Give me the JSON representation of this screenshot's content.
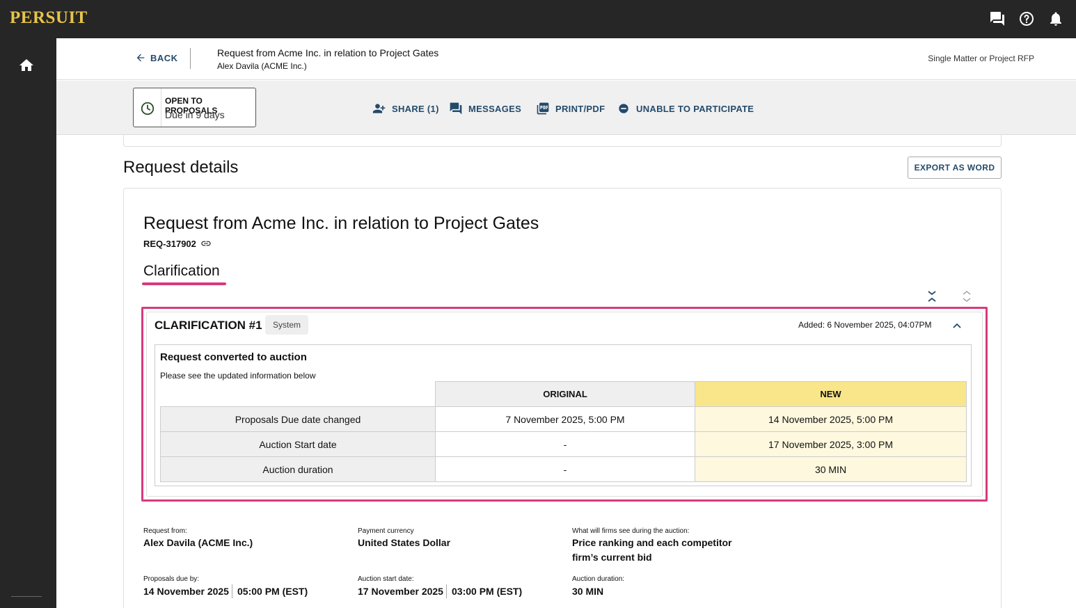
{
  "app": {
    "logo": "PERSUIT"
  },
  "header": {
    "back_label": "BACK",
    "request_title": "Request from Acme Inc. in relation to Project Gates",
    "requester": "Alex Davila (ACME Inc.)",
    "rfp_type": "Single Matter or Project RFP"
  },
  "status": {
    "title": "OPEN TO PROPOSALS",
    "due": "Due in 9 days"
  },
  "actions": {
    "share": "SHARE (1)",
    "messages": "MESSAGES",
    "print": "PRINT/PDF",
    "unable": "UNABLE TO PARTICIPATE"
  },
  "main": {
    "section_title": "Request details",
    "export_label": "EXPORT AS WORD",
    "doc_title": "Request from Acme Inc. in relation to Project Gates",
    "ref_id": "REQ-317902",
    "tab_label": "Clarification"
  },
  "clarification": {
    "heading": "CLARIFICATION #1",
    "badge": "System",
    "added": "Added: 6 November 2025, 04:07PM",
    "change_title": "Request converted to auction",
    "change_sub": "Please see the updated information below",
    "col_original": "ORIGINAL",
    "col_new": "NEW",
    "rows": [
      {
        "label": "Proposals Due date changed",
        "original": "7 November 2025, 5:00 PM",
        "new": "14 November 2025, 5:00 PM"
      },
      {
        "label": "Auction Start date",
        "original": "-",
        "new": "17 November 2025, 3:00 PM"
      },
      {
        "label": "Auction duration",
        "original": "-",
        "new": "30 MIN"
      }
    ]
  },
  "info": {
    "request_from_label": "Request from:",
    "request_from": "Alex Davila (ACME Inc.)",
    "currency_label": "Payment currency",
    "currency": "United States Dollar",
    "visibility_label": "What will firms see during the auction:",
    "visibility": "Price ranking and each competitor firm’s current bid",
    "due_label": "Proposals due by:",
    "due_date": "14 November 2025",
    "due_time": "05:00 PM (EST)",
    "start_label": "Auction start date:",
    "start_date": "17 November 2025",
    "start_time": "03:00 PM (EST)",
    "duration_label": "Auction duration:",
    "duration": "30 MIN"
  }
}
